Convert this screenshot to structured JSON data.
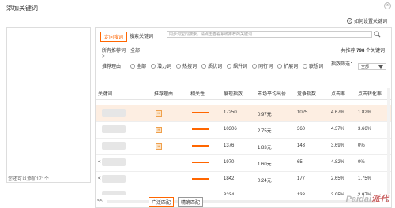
{
  "dialog": {
    "title": "添加关键词",
    "help": "如何设置关键词"
  },
  "left": {
    "count_text": "您还可以添加171个"
  },
  "tabs": {
    "active": "定向搜词",
    "other": "搜索关键词",
    "search_placeholder": "同步淘宝同搜索，请点击查看系统推荐的关键词"
  },
  "filter": {
    "all_recommend": "所有推荐词",
    "all": "全部",
    "count_prefix": "共推荐",
    "count": "798",
    "count_suffix": "个关键词",
    "arrow": ">"
  },
  "reason": {
    "label": "推荐理由：",
    "options": [
      "全部",
      "潜力词",
      "热搜词",
      "质优词",
      "飙升词",
      "同行词",
      "扩展词",
      "联想词"
    ],
    "index_label": "指数筛选：",
    "index_value": "全部"
  },
  "table": {
    "headers": [
      "关键词",
      "推荐理由",
      "相关性",
      "展现指数",
      "市场平均出价",
      "竞争指数",
      "点击率",
      "点击转化率"
    ],
    "rows": [
      {
        "kw_prefix": "",
        "hot": "H",
        "impressions": "17250",
        "bid": "0.97元",
        "competition": "1025",
        "ctr": "4.67%",
        "cvr": "1.82%"
      },
      {
        "kw_prefix": "",
        "hot": "H",
        "impressions": "10306",
        "bid": "2.75元",
        "competition": "360",
        "ctr": "4.37%",
        "cvr": "3.66%"
      },
      {
        "kw_prefix": "",
        "hot": "H",
        "impressions": "1376",
        "bid": "1.83元",
        "competition": "143",
        "ctr": "3.69%",
        "cvr": "0%"
      },
      {
        "kw_prefix": "<",
        "hot": "",
        "impressions": "1970",
        "bid": "1.60元",
        "competition": "65",
        "ctr": "4.82%",
        "cvr": "0%"
      },
      {
        "kw_prefix": "<",
        "hot": "",
        "impressions": "1842",
        "bid": "0.24元",
        "competition": "177",
        "ctr": "2.65%",
        "cvr": "1.75%"
      },
      {
        "kw_prefix": "",
        "hot": "",
        "impressions": "3234",
        "bid": "1.01元",
        "competition": "138",
        "ctr": "3.95%",
        "cvr": "3.97%"
      }
    ]
  },
  "footer": {
    "broad": "广泛匹配",
    "exact": "精确匹配",
    "left_arrow": "<<",
    "right_arrow": ">"
  },
  "watermark": {
    "brand": "Paidai",
    "suffix": "派代"
  },
  "colors": {
    "accent": "#ff6600",
    "highlight_row": "#fdeee2"
  }
}
